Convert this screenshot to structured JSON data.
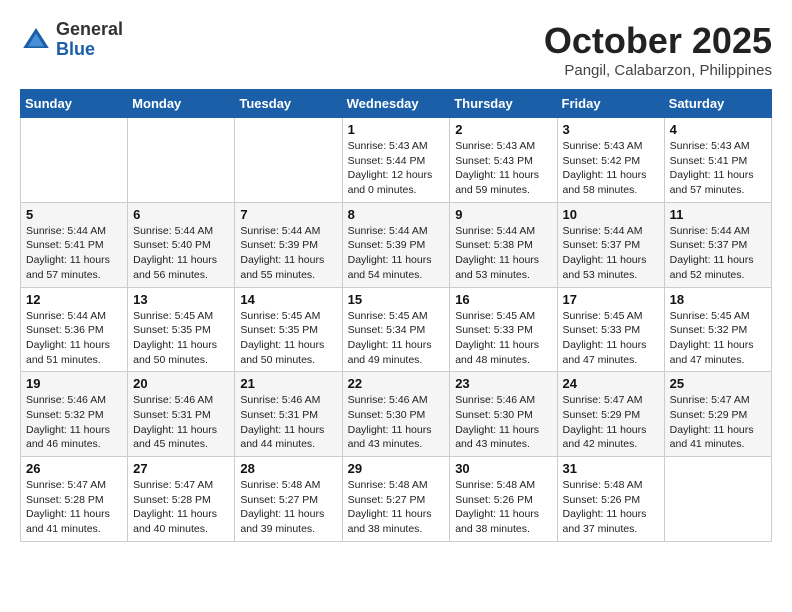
{
  "header": {
    "logo_general": "General",
    "logo_blue": "Blue",
    "month_title": "October 2025",
    "location": "Pangil, Calabarzon, Philippines"
  },
  "days_of_week": [
    "Sunday",
    "Monday",
    "Tuesday",
    "Wednesday",
    "Thursday",
    "Friday",
    "Saturday"
  ],
  "weeks": [
    [
      {
        "day": "",
        "content": ""
      },
      {
        "day": "",
        "content": ""
      },
      {
        "day": "",
        "content": ""
      },
      {
        "day": "1",
        "content": "Sunrise: 5:43 AM\nSunset: 5:44 PM\nDaylight: 12 hours\nand 0 minutes."
      },
      {
        "day": "2",
        "content": "Sunrise: 5:43 AM\nSunset: 5:43 PM\nDaylight: 11 hours\nand 59 minutes."
      },
      {
        "day": "3",
        "content": "Sunrise: 5:43 AM\nSunset: 5:42 PM\nDaylight: 11 hours\nand 58 minutes."
      },
      {
        "day": "4",
        "content": "Sunrise: 5:43 AM\nSunset: 5:41 PM\nDaylight: 11 hours\nand 57 minutes."
      }
    ],
    [
      {
        "day": "5",
        "content": "Sunrise: 5:44 AM\nSunset: 5:41 PM\nDaylight: 11 hours\nand 57 minutes."
      },
      {
        "day": "6",
        "content": "Sunrise: 5:44 AM\nSunset: 5:40 PM\nDaylight: 11 hours\nand 56 minutes."
      },
      {
        "day": "7",
        "content": "Sunrise: 5:44 AM\nSunset: 5:39 PM\nDaylight: 11 hours\nand 55 minutes."
      },
      {
        "day": "8",
        "content": "Sunrise: 5:44 AM\nSunset: 5:39 PM\nDaylight: 11 hours\nand 54 minutes."
      },
      {
        "day": "9",
        "content": "Sunrise: 5:44 AM\nSunset: 5:38 PM\nDaylight: 11 hours\nand 53 minutes."
      },
      {
        "day": "10",
        "content": "Sunrise: 5:44 AM\nSunset: 5:37 PM\nDaylight: 11 hours\nand 53 minutes."
      },
      {
        "day": "11",
        "content": "Sunrise: 5:44 AM\nSunset: 5:37 PM\nDaylight: 11 hours\nand 52 minutes."
      }
    ],
    [
      {
        "day": "12",
        "content": "Sunrise: 5:44 AM\nSunset: 5:36 PM\nDaylight: 11 hours\nand 51 minutes."
      },
      {
        "day": "13",
        "content": "Sunrise: 5:45 AM\nSunset: 5:35 PM\nDaylight: 11 hours\nand 50 minutes."
      },
      {
        "day": "14",
        "content": "Sunrise: 5:45 AM\nSunset: 5:35 PM\nDaylight: 11 hours\nand 50 minutes."
      },
      {
        "day": "15",
        "content": "Sunrise: 5:45 AM\nSunset: 5:34 PM\nDaylight: 11 hours\nand 49 minutes."
      },
      {
        "day": "16",
        "content": "Sunrise: 5:45 AM\nSunset: 5:33 PM\nDaylight: 11 hours\nand 48 minutes."
      },
      {
        "day": "17",
        "content": "Sunrise: 5:45 AM\nSunset: 5:33 PM\nDaylight: 11 hours\nand 47 minutes."
      },
      {
        "day": "18",
        "content": "Sunrise: 5:45 AM\nSunset: 5:32 PM\nDaylight: 11 hours\nand 47 minutes."
      }
    ],
    [
      {
        "day": "19",
        "content": "Sunrise: 5:46 AM\nSunset: 5:32 PM\nDaylight: 11 hours\nand 46 minutes."
      },
      {
        "day": "20",
        "content": "Sunrise: 5:46 AM\nSunset: 5:31 PM\nDaylight: 11 hours\nand 45 minutes."
      },
      {
        "day": "21",
        "content": "Sunrise: 5:46 AM\nSunset: 5:31 PM\nDaylight: 11 hours\nand 44 minutes."
      },
      {
        "day": "22",
        "content": "Sunrise: 5:46 AM\nSunset: 5:30 PM\nDaylight: 11 hours\nand 43 minutes."
      },
      {
        "day": "23",
        "content": "Sunrise: 5:46 AM\nSunset: 5:30 PM\nDaylight: 11 hours\nand 43 minutes."
      },
      {
        "day": "24",
        "content": "Sunrise: 5:47 AM\nSunset: 5:29 PM\nDaylight: 11 hours\nand 42 minutes."
      },
      {
        "day": "25",
        "content": "Sunrise: 5:47 AM\nSunset: 5:29 PM\nDaylight: 11 hours\nand 41 minutes."
      }
    ],
    [
      {
        "day": "26",
        "content": "Sunrise: 5:47 AM\nSunset: 5:28 PM\nDaylight: 11 hours\nand 41 minutes."
      },
      {
        "day": "27",
        "content": "Sunrise: 5:47 AM\nSunset: 5:28 PM\nDaylight: 11 hours\nand 40 minutes."
      },
      {
        "day": "28",
        "content": "Sunrise: 5:48 AM\nSunset: 5:27 PM\nDaylight: 11 hours\nand 39 minutes."
      },
      {
        "day": "29",
        "content": "Sunrise: 5:48 AM\nSunset: 5:27 PM\nDaylight: 11 hours\nand 38 minutes."
      },
      {
        "day": "30",
        "content": "Sunrise: 5:48 AM\nSunset: 5:26 PM\nDaylight: 11 hours\nand 38 minutes."
      },
      {
        "day": "31",
        "content": "Sunrise: 5:48 AM\nSunset: 5:26 PM\nDaylight: 11 hours\nand 37 minutes."
      },
      {
        "day": "",
        "content": ""
      }
    ]
  ]
}
